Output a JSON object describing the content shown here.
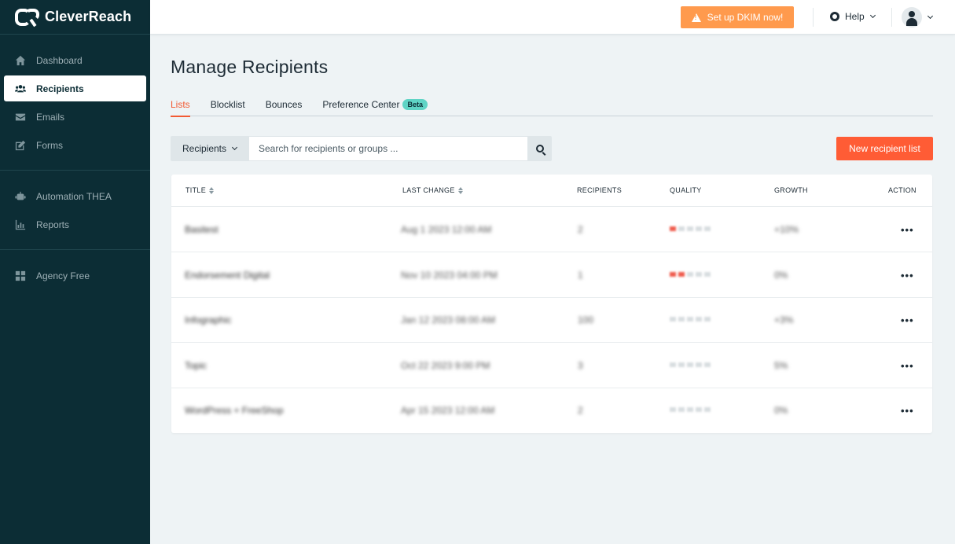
{
  "app": {
    "brand": "CleverReach"
  },
  "sidebar": {
    "items": [
      {
        "label": "Dashboard",
        "icon": "home-icon"
      },
      {
        "label": "Recipients",
        "icon": "users-icon",
        "active": true
      },
      {
        "label": "Emails",
        "icon": "envelope-icon"
      },
      {
        "label": "Forms",
        "icon": "edit-icon"
      },
      {
        "label": "Automation THEA",
        "icon": "robot-icon"
      },
      {
        "label": "Reports",
        "icon": "bar-chart-icon"
      },
      {
        "label": "Agency Free",
        "icon": "grid-icon"
      }
    ]
  },
  "topbar": {
    "dkim_label": "Set up DKIM now!",
    "help_label": "Help"
  },
  "page": {
    "title": "Manage Recipients",
    "tabs": [
      {
        "label": "Lists",
        "active": true
      },
      {
        "label": "Blocklist"
      },
      {
        "label": "Bounces"
      },
      {
        "label": "Preference Center",
        "badge": "Beta"
      }
    ]
  },
  "search": {
    "filter_label": "Recipients",
    "placeholder": "Search for recipients or groups ..."
  },
  "actions": {
    "new_list_label": "New recipient list"
  },
  "table": {
    "columns": [
      "TITLE",
      "LAST CHANGE",
      "RECIPIENTS",
      "QUALITY",
      "GROWTH",
      "ACTION"
    ],
    "rows": [
      {
        "title": "Basitest",
        "last_change": "Aug 1 2023 12:00 AM",
        "recipients": "2",
        "quality_red": 1,
        "growth": "+10%",
        "action": "•••"
      },
      {
        "title": "Endorsement Digital",
        "last_change": "Nov 10 2023 04:00 PM",
        "recipients": "1",
        "quality_red": 2,
        "growth": "0%",
        "action": "•••"
      },
      {
        "title": "Infographic",
        "last_change": "Jan 12 2023 08:00 AM",
        "recipients": "100",
        "quality_red": 0,
        "growth": "+3%",
        "action": "•••"
      },
      {
        "title": "Topic",
        "last_change": "Oct 22 2023 9:00 PM",
        "recipients": "3",
        "quality_red": 0,
        "growth": "5%",
        "action": "•••"
      },
      {
        "title": "WordPress + FreeShop",
        "last_change": "Apr 15 2023 12:00 AM",
        "recipients": "2",
        "quality_red": 0,
        "growth": "0%",
        "action": "•••"
      }
    ]
  },
  "colors": {
    "sidebar_bg": "#0c2d35",
    "accent": "#ff5c35",
    "warning": "#ff9a4d",
    "beta_badge": "#5fd4c5"
  }
}
